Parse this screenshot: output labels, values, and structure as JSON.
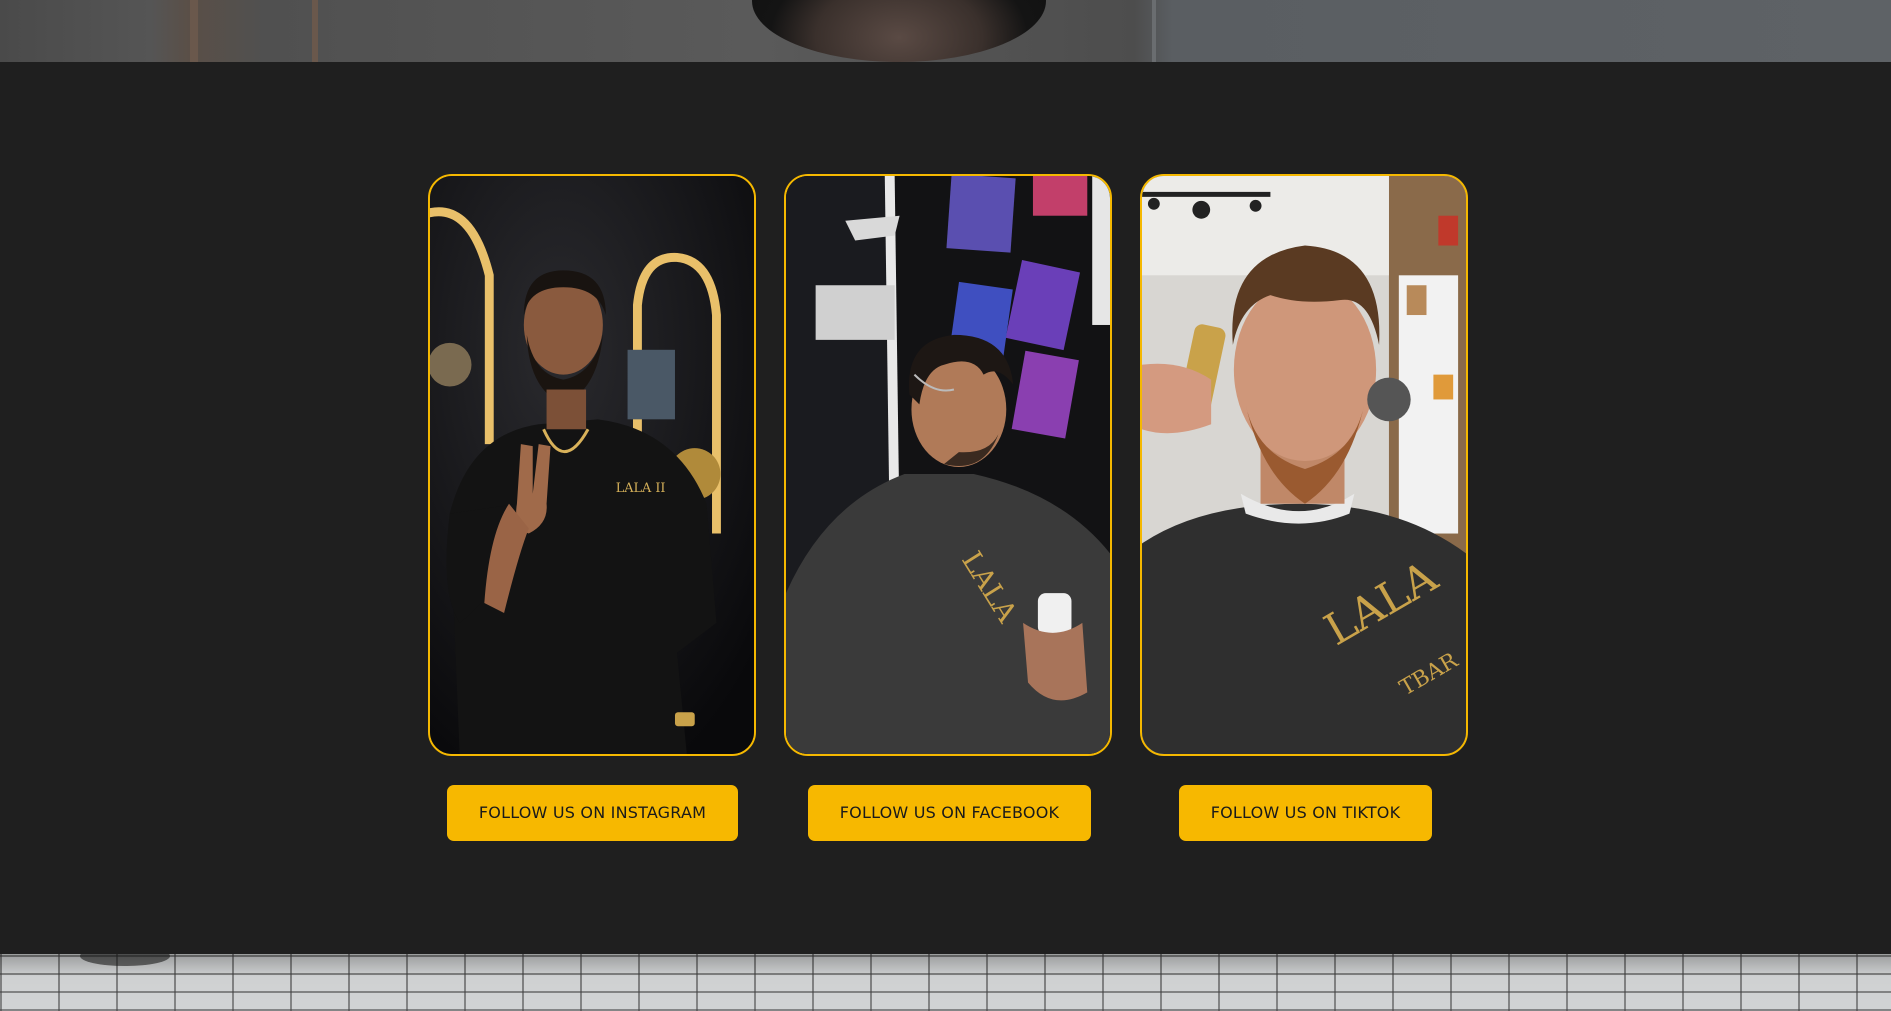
{
  "cards": [
    {
      "image": "barber-posing-peace-sign-photo"
    },
    {
      "image": "client-side-profile-haircut-photo"
    },
    {
      "image": "client-getting-trimmed-photo"
    }
  ],
  "buttons": {
    "instagram": "FOLLOW US ON INSTAGRAM",
    "facebook": "FOLLOW US ON FACEBOOK",
    "tiktok": "FOLLOW US ON TIKTOK"
  },
  "colors": {
    "accent": "#f7b800",
    "background": "#1f1f1f",
    "button_text": "#1a1a1a"
  }
}
